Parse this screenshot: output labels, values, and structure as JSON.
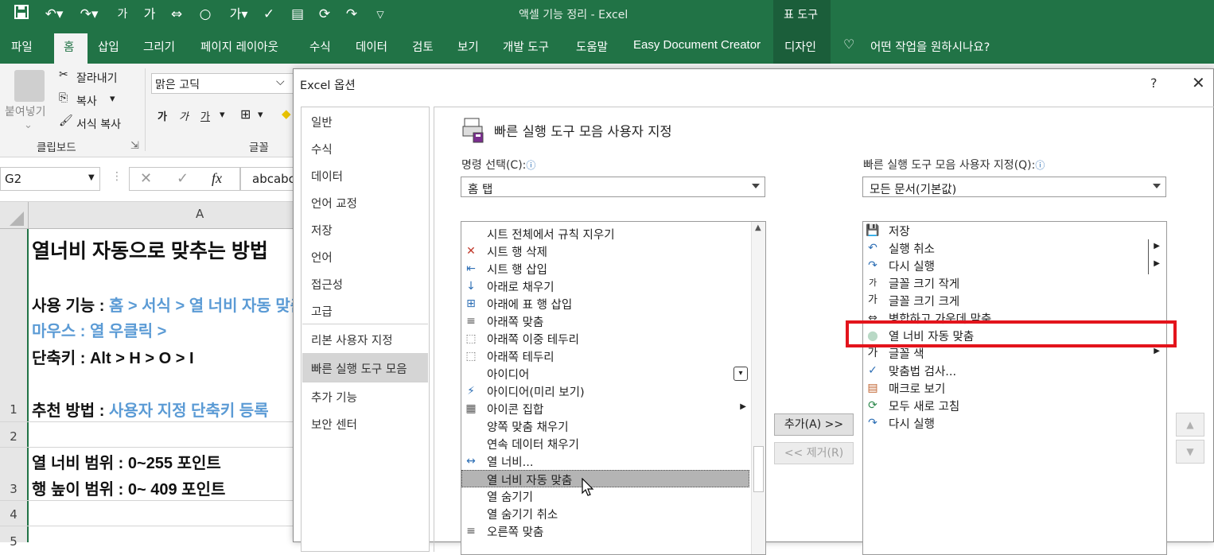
{
  "window": {
    "title": "액셀 기능 정리  -  Excel",
    "context_tool": "표 도구"
  },
  "qat": {
    "font_small_glyph": "가",
    "font_big_glyph": "가",
    "font_color_glyph": "가"
  },
  "ribbon_tabs": [
    "파일",
    "홈",
    "삽입",
    "그리기",
    "페이지 레이아웃",
    "수식",
    "데이터",
    "검토",
    "보기",
    "개발 도구",
    "도움말",
    "Easy Document Creator",
    "디자인"
  ],
  "tell_me": "어떤 작업을 원하시나요?",
  "ribbon": {
    "paste": "붙여넣기",
    "cut": "잘라내기",
    "copy": "복사",
    "format_painter": "서식 복사",
    "clipboard_group": "클립보드",
    "font_name": "맑은 고딕",
    "font_group": "글꼴",
    "bold": "가",
    "italic": "가",
    "underline": "가"
  },
  "formula_bar": {
    "name_box": "G2",
    "cancel": "✕",
    "enter": "✓",
    "fx": "fx",
    "content": "abcabc"
  },
  "sheet": {
    "column_header": "A",
    "row_numbers": [
      "1",
      "2",
      "3",
      "4",
      "5"
    ],
    "lines": [
      {
        "label": "열너비 자동으로 맞추는 방법",
        "value": ""
      },
      {
        "label": "사용 기능 : ",
        "value": "홈 > 서식 > 열 너비 자동 맞춤"
      },
      {
        "label": "",
        "value": "마우스 : 열 우클릭 >"
      },
      {
        "label": "단축키 : Alt > H > O > I",
        "value": ""
      },
      {
        "label": "추천 방법 : ",
        "value": "사용자 지정 단축키 등록"
      },
      {
        "label": "열 너비 범위 : 0~255 포인트",
        "value": ""
      },
      {
        "label": "행 높이 범위 : 0~ 409 포인트",
        "value": ""
      }
    ]
  },
  "dialog": {
    "title": "Excel 옵션",
    "help": "?",
    "close": "✕",
    "nav": [
      "일반",
      "수식",
      "데이터",
      "언어 교정",
      "저장",
      "언어",
      "접근성",
      "고급",
      "리본 사용자 지정",
      "빠른 실행 도구 모음",
      "추가 기능",
      "보안 센터"
    ],
    "section_title": "빠른 실행 도구 모음 사용자 지정",
    "left_label": "명령 선택(C):",
    "left_combo": "홈 탭",
    "right_label": "빠른 실행 도구 모음 사용자 지정(Q):",
    "right_combo": "모든 문서(기본값)",
    "info_icon": "ⓘ",
    "add_button": "추가(A) >>",
    "remove_button": "<< 제거(R)",
    "move_up": "▲",
    "move_down": "▼",
    "commands": [
      {
        "label": "시트 전체에서 규칙 지우기",
        "icon": "",
        "icon_name": "none"
      },
      {
        "label": "시트 행 삭제",
        "icon": "✕",
        "icon_name": "delete-row-icon"
      },
      {
        "label": "시트 행 삽입",
        "icon": "⇤",
        "icon_name": "insert-row-icon"
      },
      {
        "label": "아래로 채우기",
        "icon": "↓",
        "icon_name": "fill-down-icon"
      },
      {
        "label": "아래에 표 행 삽입",
        "icon": "⊞",
        "icon_name": "table-row-insert-icon"
      },
      {
        "label": "아래쪽 맞춤",
        "icon": "≡",
        "icon_name": "align-bottom-icon"
      },
      {
        "label": "아래쪽 이중 테두리",
        "icon": "⬚",
        "icon_name": "double-border-icon"
      },
      {
        "label": "아래쪽 테두리",
        "icon": "⬚",
        "icon_name": "bottom-border-icon"
      },
      {
        "label": "아이디어",
        "icon": "",
        "icon_name": "none"
      },
      {
        "label": "아이디어(미리 보기)",
        "icon": "⚡",
        "icon_name": "ideas-lightning-icon"
      },
      {
        "label": "아이콘 집합",
        "icon": "▦",
        "icon_name": "icon-set-icon"
      },
      {
        "label": "양쪽 맞춤 채우기",
        "icon": "",
        "icon_name": "none"
      },
      {
        "label": "연속 데이터 채우기",
        "icon": "",
        "icon_name": "none"
      },
      {
        "label": "열 너비...",
        "icon": "↔",
        "icon_name": "column-width-icon"
      },
      {
        "label": "열 너비 자동 맞춤",
        "icon": "",
        "icon_name": "none"
      },
      {
        "label": "열 숨기기",
        "icon": "",
        "icon_name": "none"
      },
      {
        "label": "열 숨기기 취소",
        "icon": "",
        "icon_name": "none"
      },
      {
        "label": "오른쪽 맞춤",
        "icon": "≡",
        "icon_name": "align-right-icon"
      }
    ],
    "toolbar_items": [
      {
        "label": "저장",
        "icon": "💾",
        "icon_name": "save-icon"
      },
      {
        "label": "실행 취소",
        "icon": "↶",
        "icon_name": "undo-icon"
      },
      {
        "label": "다시 실행",
        "icon": "↷",
        "icon_name": "redo-icon"
      },
      {
        "label": "글꼴 크기 작게",
        "icon": "가",
        "icon_name": "font-smaller-icon"
      },
      {
        "label": "글꼴 크기 크게",
        "icon": "가",
        "icon_name": "font-larger-icon"
      },
      {
        "label": "병합하고 가운데 맞춤",
        "icon": "⇔",
        "icon_name": "merge-center-icon"
      },
      {
        "label": "열 너비 자동 맞춤",
        "icon": "●",
        "icon_name": "autofit-circle-icon"
      },
      {
        "label": "글꼴 색",
        "icon": "가",
        "icon_name": "font-color-icon"
      },
      {
        "label": "맞춤법 검사...",
        "icon": "✓",
        "icon_name": "spelling-icon"
      },
      {
        "label": "매크로 보기",
        "icon": "▤",
        "icon_name": "macro-icon"
      },
      {
        "label": "모두 새로 고침",
        "icon": "⟳",
        "icon_name": "refresh-all-icon"
      },
      {
        "label": "다시 실행",
        "icon": "↷",
        "icon_name": "redo-icon"
      }
    ]
  },
  "colors": {
    "excel_green": "#217346",
    "highlight": "#e3141c",
    "link_blue": "#5b9bd5"
  }
}
